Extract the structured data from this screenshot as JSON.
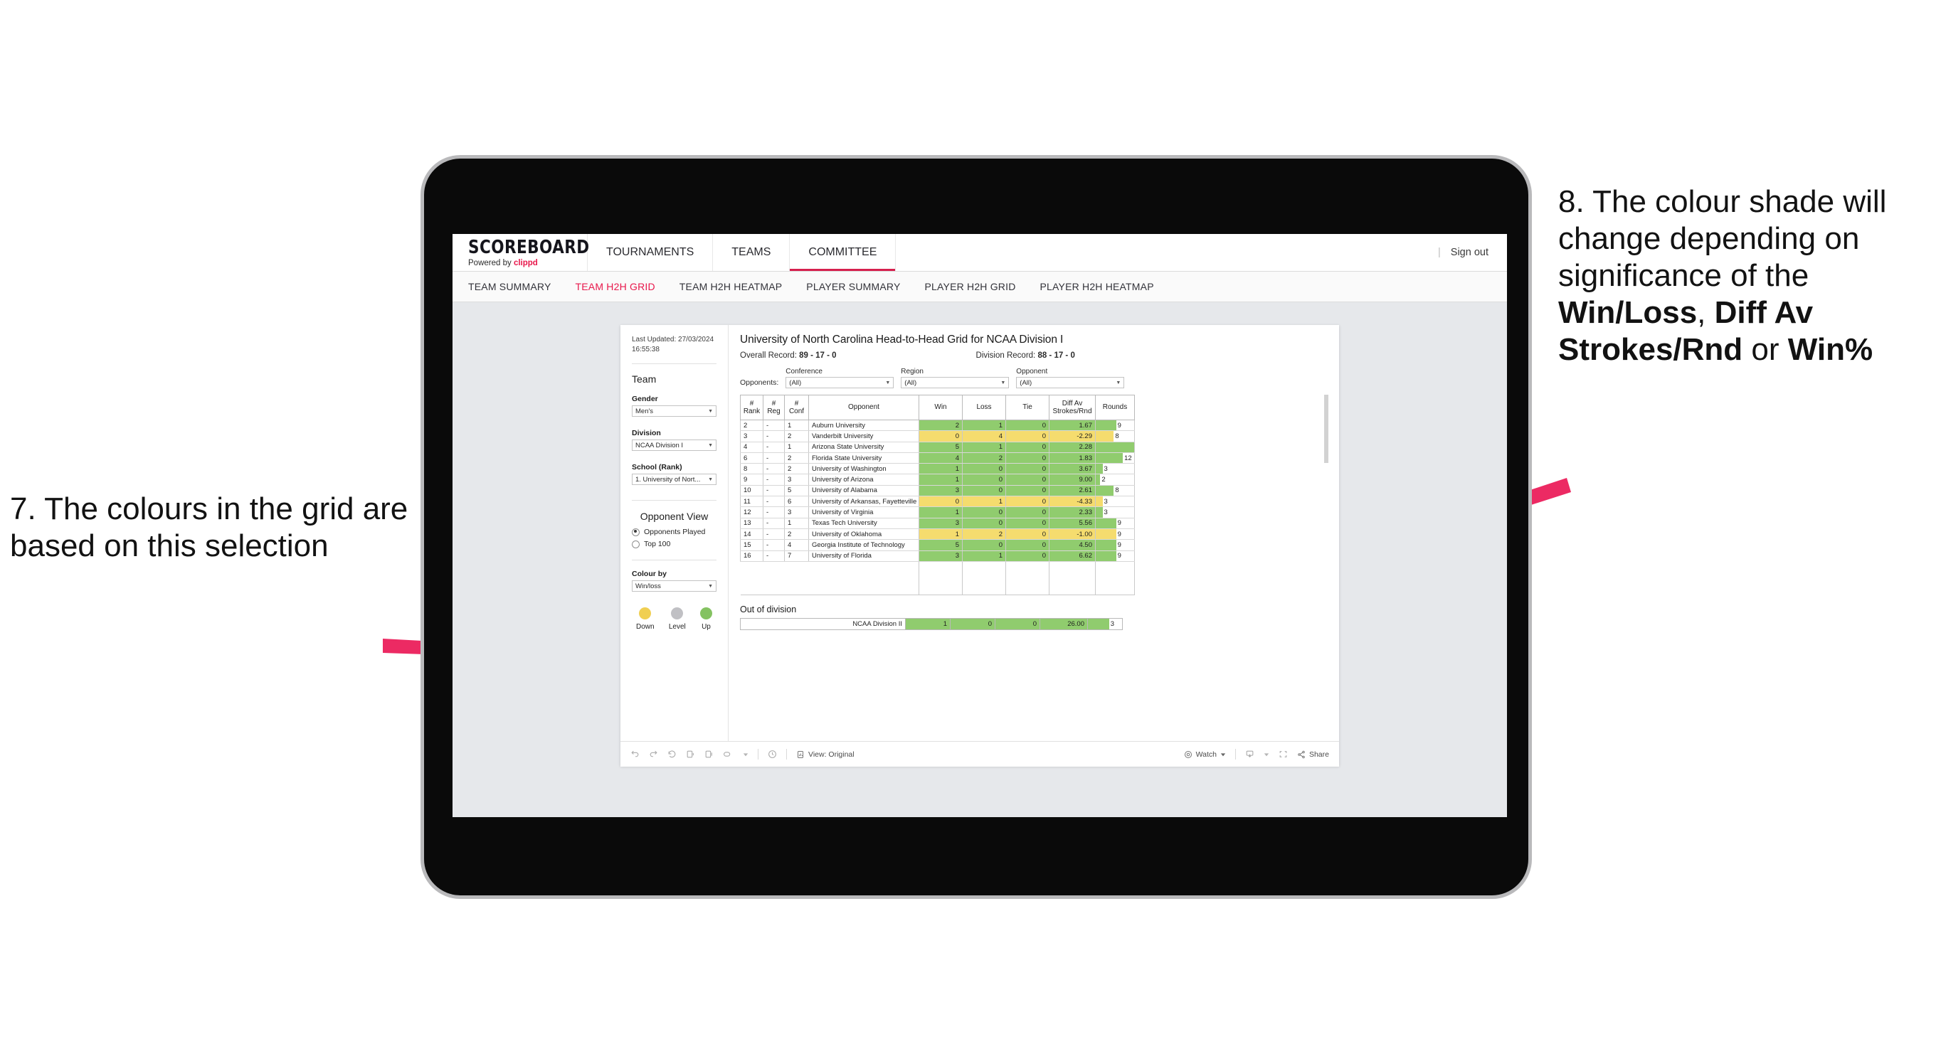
{
  "annotations": {
    "left": {
      "text": "7. The colours in the grid are based on this selection",
      "arrow_color": "#ec2a63"
    },
    "right": {
      "prefix": "8. The colour shade will change depending on significance of the ",
      "bold1": "Win/Loss",
      "mid1": ", ",
      "bold2": "Diff Av Strokes/Rnd",
      "mid2": " or ",
      "bold3": "Win%",
      "arrow_color": "#ec2a63"
    }
  },
  "app": {
    "brand": {
      "name": "SCOREBOARD",
      "powered_prefix": "Powered by ",
      "powered_brand": "clippd"
    },
    "main_nav": [
      {
        "label": "TOURNAMENTS",
        "active": false
      },
      {
        "label": "TEAMS",
        "active": false
      },
      {
        "label": "COMMITTEE",
        "active": true
      }
    ],
    "sign_out": "Sign out",
    "sub_nav": [
      {
        "label": "TEAM SUMMARY",
        "active": false
      },
      {
        "label": "TEAM H2H GRID",
        "active": true
      },
      {
        "label": "TEAM H2H HEATMAP",
        "active": false
      },
      {
        "label": "PLAYER SUMMARY",
        "active": false
      },
      {
        "label": "PLAYER H2H GRID",
        "active": false
      },
      {
        "label": "PLAYER H2H HEATMAP",
        "active": false
      }
    ]
  },
  "sidebar": {
    "last_updated": "Last Updated: 27/03/2024 16:55:38",
    "team_heading": "Team",
    "gender_label": "Gender",
    "gender_value": "Men's",
    "division_label": "Division",
    "division_value": "NCAA Division I",
    "school_label": "School (Rank)",
    "school_value": "1. University of Nort...",
    "opponent_view_heading": "Opponent View",
    "opponent_view_options": [
      {
        "label": "Opponents Played",
        "selected": true
      },
      {
        "label": "Top 100",
        "selected": false
      }
    ],
    "colour_by_label": "Colour by",
    "colour_by_value": "Win/loss",
    "legend": [
      {
        "label": "Down",
        "color": "#f0cf52"
      },
      {
        "label": "Level",
        "color": "#c0c0c4"
      },
      {
        "label": "Up",
        "color": "#84c261"
      }
    ]
  },
  "main": {
    "title": "University of North Carolina Head-to-Head Grid for NCAA Division I",
    "overall_record_label": "Overall Record: ",
    "overall_record_value": "89 - 17 - 0",
    "division_record_label": "Division Record: ",
    "division_record_value": "88 - 17 - 0",
    "opponents_label": "Opponents:",
    "filters": [
      {
        "label": "Conference",
        "value": "(All)"
      },
      {
        "label": "Region",
        "value": "(All)"
      },
      {
        "label": "Opponent",
        "value": "(All)"
      }
    ],
    "table": {
      "headers": [
        "# Rank",
        "# Reg",
        "# Conf",
        "Opponent",
        "Win",
        "Loss",
        "Tie",
        "Diff Av Strokes/Rnd",
        "Rounds"
      ],
      "header_lines": [
        [
          "#",
          "Rank"
        ],
        [
          "#",
          "Reg"
        ],
        [
          "#",
          "Conf"
        ],
        [
          "Opponent"
        ],
        [
          "Win"
        ],
        [
          "Loss"
        ],
        [
          "Tie"
        ],
        [
          "Diff Av",
          "Strokes/Rnd"
        ],
        [
          "Rounds"
        ]
      ],
      "colors": {
        "up": "#90cc6e",
        "down": "#f5dc6e"
      },
      "rounds_max": 17,
      "rows": [
        {
          "rank": "2",
          "reg": "-",
          "conf": "1",
          "opponent": "Auburn University",
          "win": "2",
          "loss": "1",
          "tie": "0",
          "diff": "1.67",
          "rounds": "9",
          "state": "up"
        },
        {
          "rank": "3",
          "reg": "-",
          "conf": "2",
          "opponent": "Vanderbilt University",
          "win": "0",
          "loss": "4",
          "tie": "0",
          "diff": "-2.29",
          "rounds": "8",
          "state": "down"
        },
        {
          "rank": "4",
          "reg": "-",
          "conf": "1",
          "opponent": "Arizona State University",
          "win": "5",
          "loss": "1",
          "tie": "0",
          "diff": "2.28",
          "rounds": "17",
          "state": "up"
        },
        {
          "rank": "6",
          "reg": "-",
          "conf": "2",
          "opponent": "Florida State University",
          "win": "4",
          "loss": "2",
          "tie": "0",
          "diff": "1.83",
          "rounds": "12",
          "state": "up"
        },
        {
          "rank": "8",
          "reg": "-",
          "conf": "2",
          "opponent": "University of Washington",
          "win": "1",
          "loss": "0",
          "tie": "0",
          "diff": "3.67",
          "rounds": "3",
          "state": "up"
        },
        {
          "rank": "9",
          "reg": "-",
          "conf": "3",
          "opponent": "University of Arizona",
          "win": "1",
          "loss": "0",
          "tie": "0",
          "diff": "9.00",
          "rounds": "2",
          "state": "up"
        },
        {
          "rank": "10",
          "reg": "-",
          "conf": "5",
          "opponent": "University of Alabama",
          "win": "3",
          "loss": "0",
          "tie": "0",
          "diff": "2.61",
          "rounds": "8",
          "state": "up"
        },
        {
          "rank": "11",
          "reg": "-",
          "conf": "6",
          "opponent": "University of Arkansas, Fayetteville",
          "win": "0",
          "loss": "1",
          "tie": "0",
          "diff": "-4.33",
          "rounds": "3",
          "state": "down"
        },
        {
          "rank": "12",
          "reg": "-",
          "conf": "3",
          "opponent": "University of Virginia",
          "win": "1",
          "loss": "0",
          "tie": "0",
          "diff": "2.33",
          "rounds": "3",
          "state": "up"
        },
        {
          "rank": "13",
          "reg": "-",
          "conf": "1",
          "opponent": "Texas Tech University",
          "win": "3",
          "loss": "0",
          "tie": "0",
          "diff": "5.56",
          "rounds": "9",
          "state": "up"
        },
        {
          "rank": "14",
          "reg": "-",
          "conf": "2",
          "opponent": "University of Oklahoma",
          "win": "1",
          "loss": "2",
          "tie": "0",
          "diff": "-1.00",
          "rounds": "9",
          "state": "down"
        },
        {
          "rank": "15",
          "reg": "-",
          "conf": "4",
          "opponent": "Georgia Institute of Technology",
          "win": "5",
          "loss": "0",
          "tie": "0",
          "diff": "4.50",
          "rounds": "9",
          "state": "up"
        },
        {
          "rank": "16",
          "reg": "-",
          "conf": "7",
          "opponent": "University of Florida",
          "win": "3",
          "loss": "1",
          "tie": "0",
          "diff": "6.62",
          "rounds": "9",
          "state": "up"
        }
      ]
    },
    "out_of_division": {
      "title": "Out of division",
      "row": {
        "label": "NCAA Division II",
        "win": "1",
        "loss": "0",
        "tie": "0",
        "diff": "26.00",
        "rounds": "3",
        "state": "up"
      }
    }
  },
  "toolbar": {
    "view_label": "View: Original",
    "watch_label": "Watch",
    "share_label": "Share"
  }
}
